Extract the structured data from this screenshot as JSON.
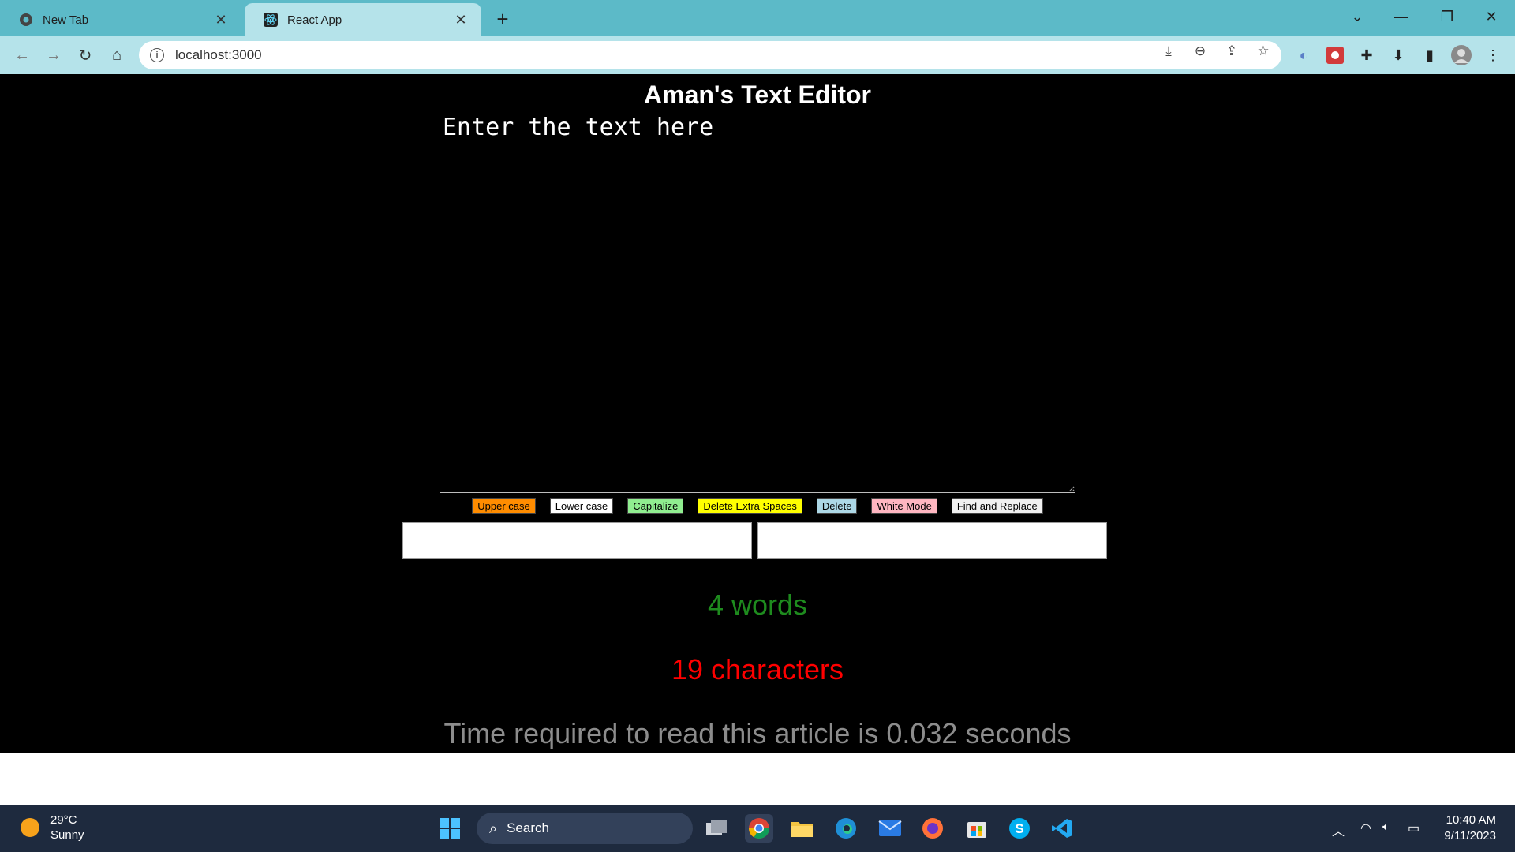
{
  "browser": {
    "tabs": [
      {
        "title": "New Tab",
        "icon": "chrome-icon"
      },
      {
        "title": "React App",
        "icon": "react-icon"
      }
    ],
    "url": "localhost:3000"
  },
  "app": {
    "title": "Aman's Text Editor",
    "textarea_placeholder": "Enter the text here",
    "buttons": [
      {
        "label": "Upper case",
        "color": "#ff8c00"
      },
      {
        "label": "Lower case",
        "color": "#ffffff"
      },
      {
        "label": "Capitalize",
        "color": "#90ee90"
      },
      {
        "label": "Delete Extra Spaces",
        "color": "#ffff00"
      },
      {
        "label": "Delete",
        "color": "#add8e6"
      },
      {
        "label": "White Mode",
        "color": "#ffb6c1"
      },
      {
        "label": "Find and Replace",
        "color": "#f0f0f0"
      }
    ],
    "stats": {
      "words": "4 words",
      "characters": "19 characters",
      "read_time": "Time required to read this article is 0.032 seconds"
    },
    "colors": {
      "words": "#1e8b1e",
      "characters": "#ff0000",
      "read_time": "#8c8c8c"
    }
  },
  "taskbar": {
    "weather_temp": "29°C",
    "weather_desc": "Sunny",
    "search_label": "Search",
    "time": "10:40 AM",
    "date": "9/11/2023"
  }
}
